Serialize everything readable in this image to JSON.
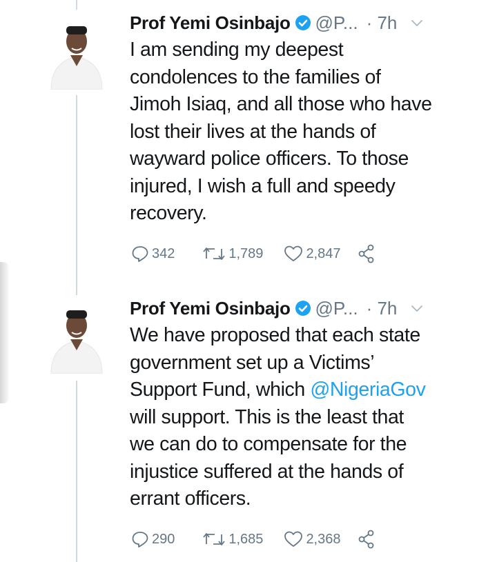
{
  "tweets": [
    {
      "name": "Prof Yemi Osinbajo",
      "handle": "@P...",
      "time": "· 7h",
      "lines": [
        "I am sending my deepest",
        "condolences to the families of",
        "Jimoh Isiaq, and all those who have",
        "lost their lives at the hands of",
        "wayward police officers. To those",
        "injured, I wish a full and speedy",
        "recovery."
      ],
      "reply_count": "342",
      "retweet_count": "1,789",
      "like_count": "2,847"
    },
    {
      "name": "Prof Yemi Osinbajo",
      "handle": "@P...",
      "time": "· 7h",
      "lines": [
        "We have proposed that each state",
        "government set up a Victims’",
        "Support Fund, which ",
        "will support. This is the least that",
        "we can do to compensate for the",
        "injustice suffered at the hands of",
        "errant officers."
      ],
      "mention": "@NigeriaGov",
      "reply_count": "290",
      "retweet_count": "1,685",
      "like_count": "2,368"
    }
  ],
  "colors": {
    "text": "#14171a",
    "secondary": "#657786",
    "link": "#1da1f2",
    "verified": "#1da1f2",
    "thread_line": "#cfd9de"
  },
  "icons": [
    "reply-icon",
    "retweet-icon",
    "like-icon",
    "share-icon",
    "verified-badge-icon",
    "chevron-down-icon"
  ]
}
